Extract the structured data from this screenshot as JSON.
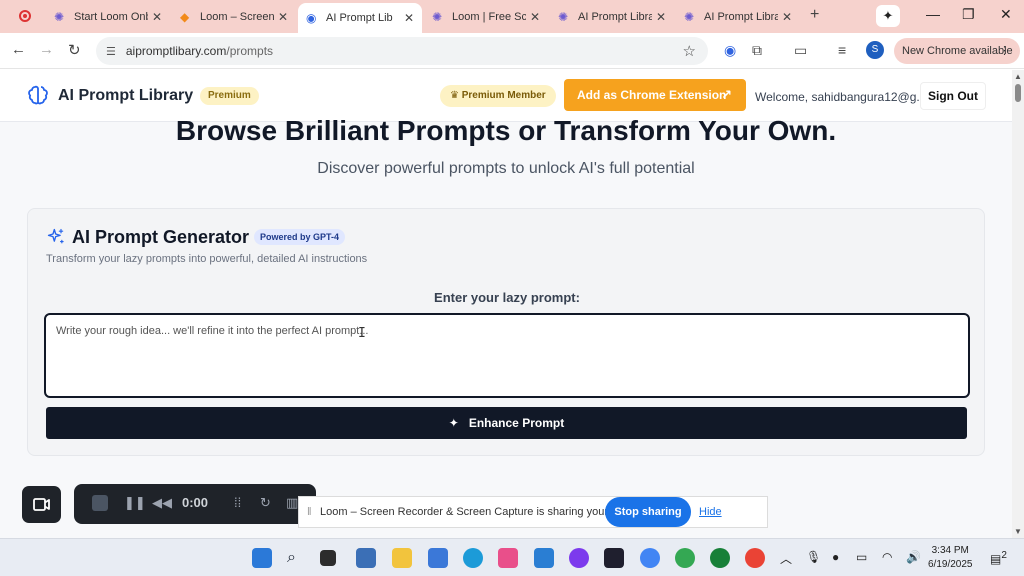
{
  "browser": {
    "tabs": [
      {
        "label": "Start Loom Onb",
        "icon": "loom-icon",
        "active": false
      },
      {
        "label": "Loom – Screen R",
        "icon": "loom-logo-icon",
        "active": false
      },
      {
        "label": "AI Prompt Lib",
        "icon": "ai-prompt-icon",
        "active": true
      },
      {
        "label": "Loom | Free Scre",
        "icon": "loom-icon",
        "active": false
      },
      {
        "label": "AI Prompt Libra",
        "icon": "loom-icon",
        "active": false
      },
      {
        "label": "AI Prompt Libra",
        "icon": "loom-icon",
        "active": false
      }
    ],
    "url_host": "aipromptlibary.com",
    "url_path": "/prompts",
    "profile_initial": "S",
    "new_chrome_label": "New Chrome available"
  },
  "header": {
    "brand_name": "AI Prompt Library",
    "premium_label": "Premium",
    "member_label": "Premium Member",
    "chrome_ext_label": "Add as Chrome Extension",
    "welcome_text": "Welcome, sahidbangura12@g...",
    "signout_label": "Sign Out"
  },
  "hero": {
    "title": "Browse Brilliant Prompts or Transform Your Own.",
    "subtitle": "Discover powerful prompts to unlock AI's full potential"
  },
  "generator": {
    "title": "AI Prompt Generator",
    "badge": "Powered by GPT-4",
    "subtitle": "Transform your lazy prompts into powerful, detailed AI instructions",
    "input_label": "Enter your lazy prompt:",
    "input_placeholder": "Write your rough idea... we'll refine it into the perfect AI prompt...",
    "button_label": "Enhance Prompt"
  },
  "loom": {
    "timer": "0:00",
    "share_message": "Loom – Screen Recorder & Screen Capture is sharing your screen.",
    "stop_sharing_label": "Stop sharing",
    "hide_label": "Hide"
  },
  "taskbar": {
    "time": "3:34 PM",
    "date": "6/19/2025",
    "notification_count": "2"
  },
  "colors": {
    "accent_orange": "#f6a21e",
    "dark_button": "#111827",
    "tab_strip": "#f6d2cd",
    "share_blue": "#1a73e8"
  }
}
